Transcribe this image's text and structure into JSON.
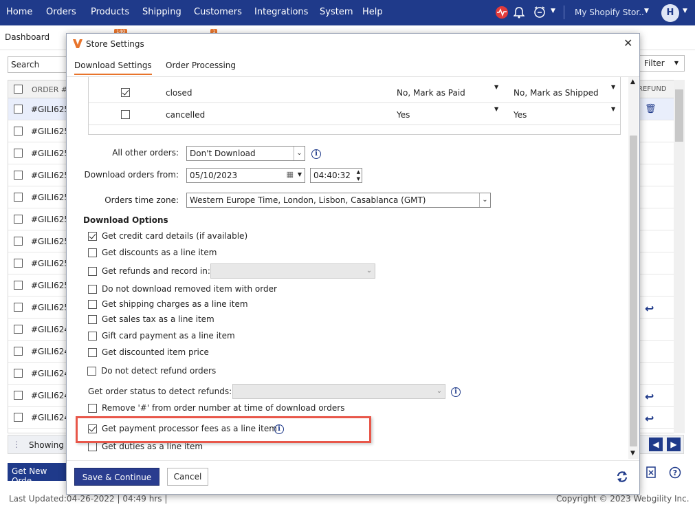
{
  "nav": {
    "items": [
      "Home",
      "Orders",
      "Products",
      "Shipping",
      "Customers",
      "Integrations",
      "System",
      "Help"
    ],
    "store_name": "My Shopify Stor..",
    "avatar_letter": "H"
  },
  "background": {
    "tab_label": "Dashboard",
    "badges": [
      "140",
      "1"
    ],
    "search_label": "Search",
    "filter_label": "Filter",
    "col_order": "ORDER #",
    "col_refund": "REFUND",
    "orders": [
      "#GILI625",
      "#GILI625",
      "#GILI625",
      "#GILI625",
      "#GILI625",
      "#GILI625",
      "#GILI625",
      "#GILI625",
      "#GILI625",
      "#GILI625",
      "#GILI624",
      "#GILI624",
      "#GILI624",
      "#GILI624",
      "#GILI624"
    ],
    "showing_label": "Showing",
    "get_new_label": "Get New Orde",
    "last_updated": "Last Updated:04-26-2022 | 04:49 hrs |",
    "copyright": "Copyright © 2023 Webgility Inc."
  },
  "modal": {
    "title": "Store Settings",
    "tabs": [
      "Download Settings",
      "Order Processing"
    ],
    "status_rows": [
      {
        "checked": true,
        "name": "closed",
        "payment": "No, Mark as Paid",
        "shipping": "No, Mark as Shipped"
      },
      {
        "checked": false,
        "name": "cancelled",
        "payment": "Yes",
        "shipping": "Yes"
      }
    ],
    "all_other_orders_label": "All other orders:",
    "all_other_orders_value": "Don't Download",
    "download_from_label": "Download orders from:",
    "download_from_date": "05/10/2023",
    "download_from_time": "04:40:32",
    "timezone_label": "Orders time zone:",
    "timezone_value": "Western Europe Time, London, Lisbon, Casablanca (GMT)",
    "download_options_title": "Download Options",
    "options": [
      {
        "label": "Get credit card details (if available)",
        "checked": true
      },
      {
        "label": "Get discounts as a line item",
        "checked": false
      },
      {
        "label": "Get refunds and record in:",
        "checked": false
      },
      {
        "label": "Do not download removed item with order",
        "checked": false
      },
      {
        "label": "Get shipping charges as a line item",
        "checked": false
      },
      {
        "label": "Get sales tax as a line item",
        "checked": false
      },
      {
        "label": "Gift card payment as a line item",
        "checked": false
      },
      {
        "label": "Get discounted item price",
        "checked": false
      },
      {
        "label": "Do not detect refund orders",
        "checked": false
      }
    ],
    "refund_status_label": "Get order status to detect refunds:",
    "remove_hash_label": "Remove '#' from order number at time of download orders",
    "processor_fees_label": "Get payment processor fees as a line item",
    "duties_label": "Get duties as a line item",
    "save_label": "Save & Continue",
    "cancel_label": "Cancel"
  },
  "colors": {
    "nav_bg": "#1f3a8a",
    "accent": "#e8742b",
    "highlight": "#e8574a",
    "primary_btn": "#2a3d8f"
  }
}
